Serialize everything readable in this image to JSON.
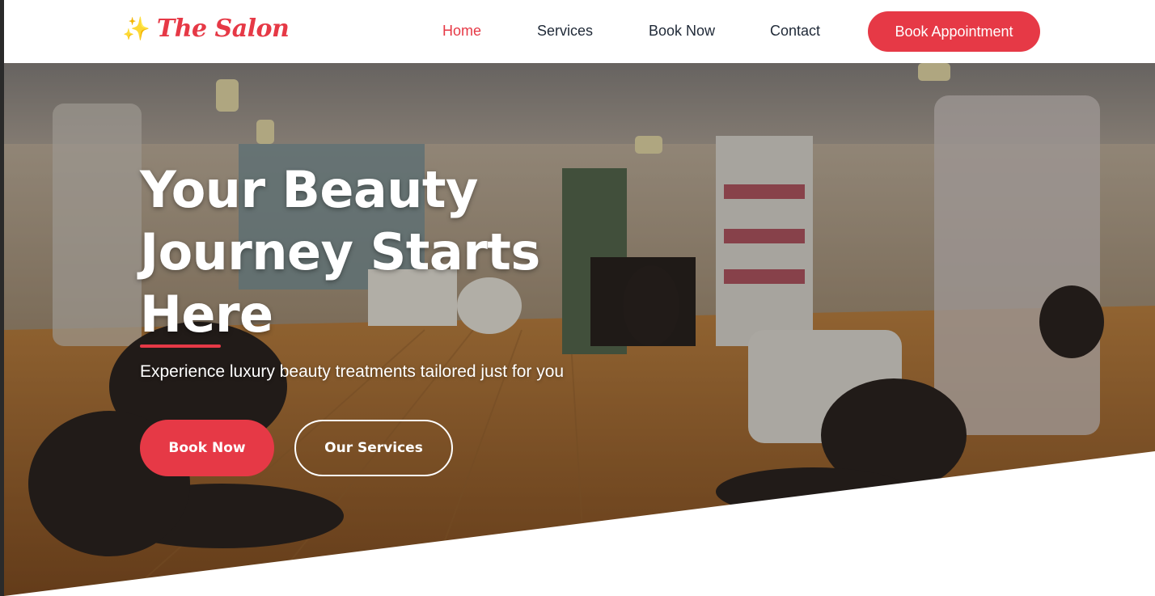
{
  "brand": {
    "logo_icon": "✨",
    "logo_icon_name": "sparkles-icon",
    "name": "The Salon",
    "accent_color": "#e63946"
  },
  "nav": {
    "links": [
      {
        "label": "Home",
        "active": true
      },
      {
        "label": "Services",
        "active": false
      },
      {
        "label": "Book Now",
        "active": false
      },
      {
        "label": "Contact",
        "active": false
      }
    ],
    "cta_label": "Book Appointment"
  },
  "hero": {
    "title": "Your Beauty Journey Starts Here",
    "subtitle": "Experience luxury beauty treatments tailored just for you",
    "primary_button": "Book Now",
    "secondary_button": "Our Services"
  }
}
